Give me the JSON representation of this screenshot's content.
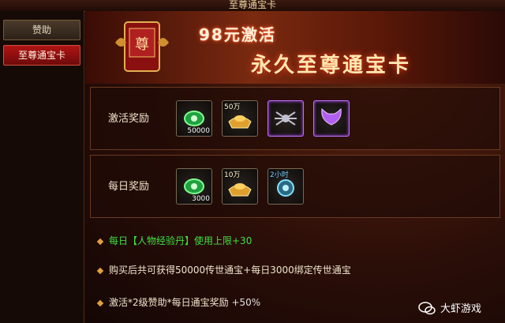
{
  "window": {
    "title": "至尊通宝卡"
  },
  "sidebar": {
    "items": [
      {
        "label": "赞助",
        "active": false
      },
      {
        "label": "至尊通宝卡",
        "active": true
      }
    ]
  },
  "banner": {
    "badge_text": "尊",
    "promo_line1": "98元激活",
    "promo_line2": "永久至尊通宝卡"
  },
  "activation_reward": {
    "label": "激活奖励",
    "items": [
      {
        "icon": "green-pill-icon",
        "qty": "50000"
      },
      {
        "icon": "gold-ingot-icon",
        "tag": "50万"
      },
      {
        "icon": "spider-emblem-icon"
      },
      {
        "icon": "purple-wings-icon"
      }
    ]
  },
  "daily_reward": {
    "label": "每日奖励",
    "items": [
      {
        "icon": "green-pill-icon",
        "qty": "3000"
      },
      {
        "icon": "gold-ingot-icon",
        "tag": "10万"
      },
      {
        "icon": "blue-orb-icon",
        "tag": "2小时"
      }
    ]
  },
  "info": {
    "line1": "每日【人物经验丹】使用上限+30",
    "line2": "购买后共可获得50000传世通宝+每日3000绑定传世通宝",
    "line3_main": "激活*2级赞助*每日通宝奖励",
    "line3_pct": "+50%"
  },
  "watermark": {
    "text": "大虾游戏",
    "icon": "wechat-icon"
  },
  "colors": {
    "accent_red": "#b01414",
    "gold": "#e0a040",
    "green_text": "#40e040"
  }
}
